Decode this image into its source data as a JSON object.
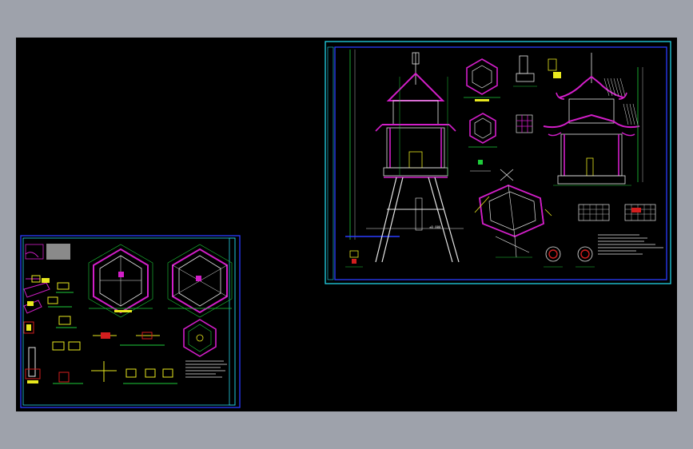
{
  "viewport": {
    "background_color": "#9ea2ab",
    "canvas_color": "#000000"
  },
  "colors": {
    "frame_blue": "#2a3cff",
    "frame_cyan": "#22d3e6",
    "magenta": "#d21ec8",
    "yellow": "#e8e81e",
    "green": "#1ecc3a",
    "white": "#e6e6e6",
    "red": "#d21e1e",
    "grey": "#8a8a8a"
  }
}
